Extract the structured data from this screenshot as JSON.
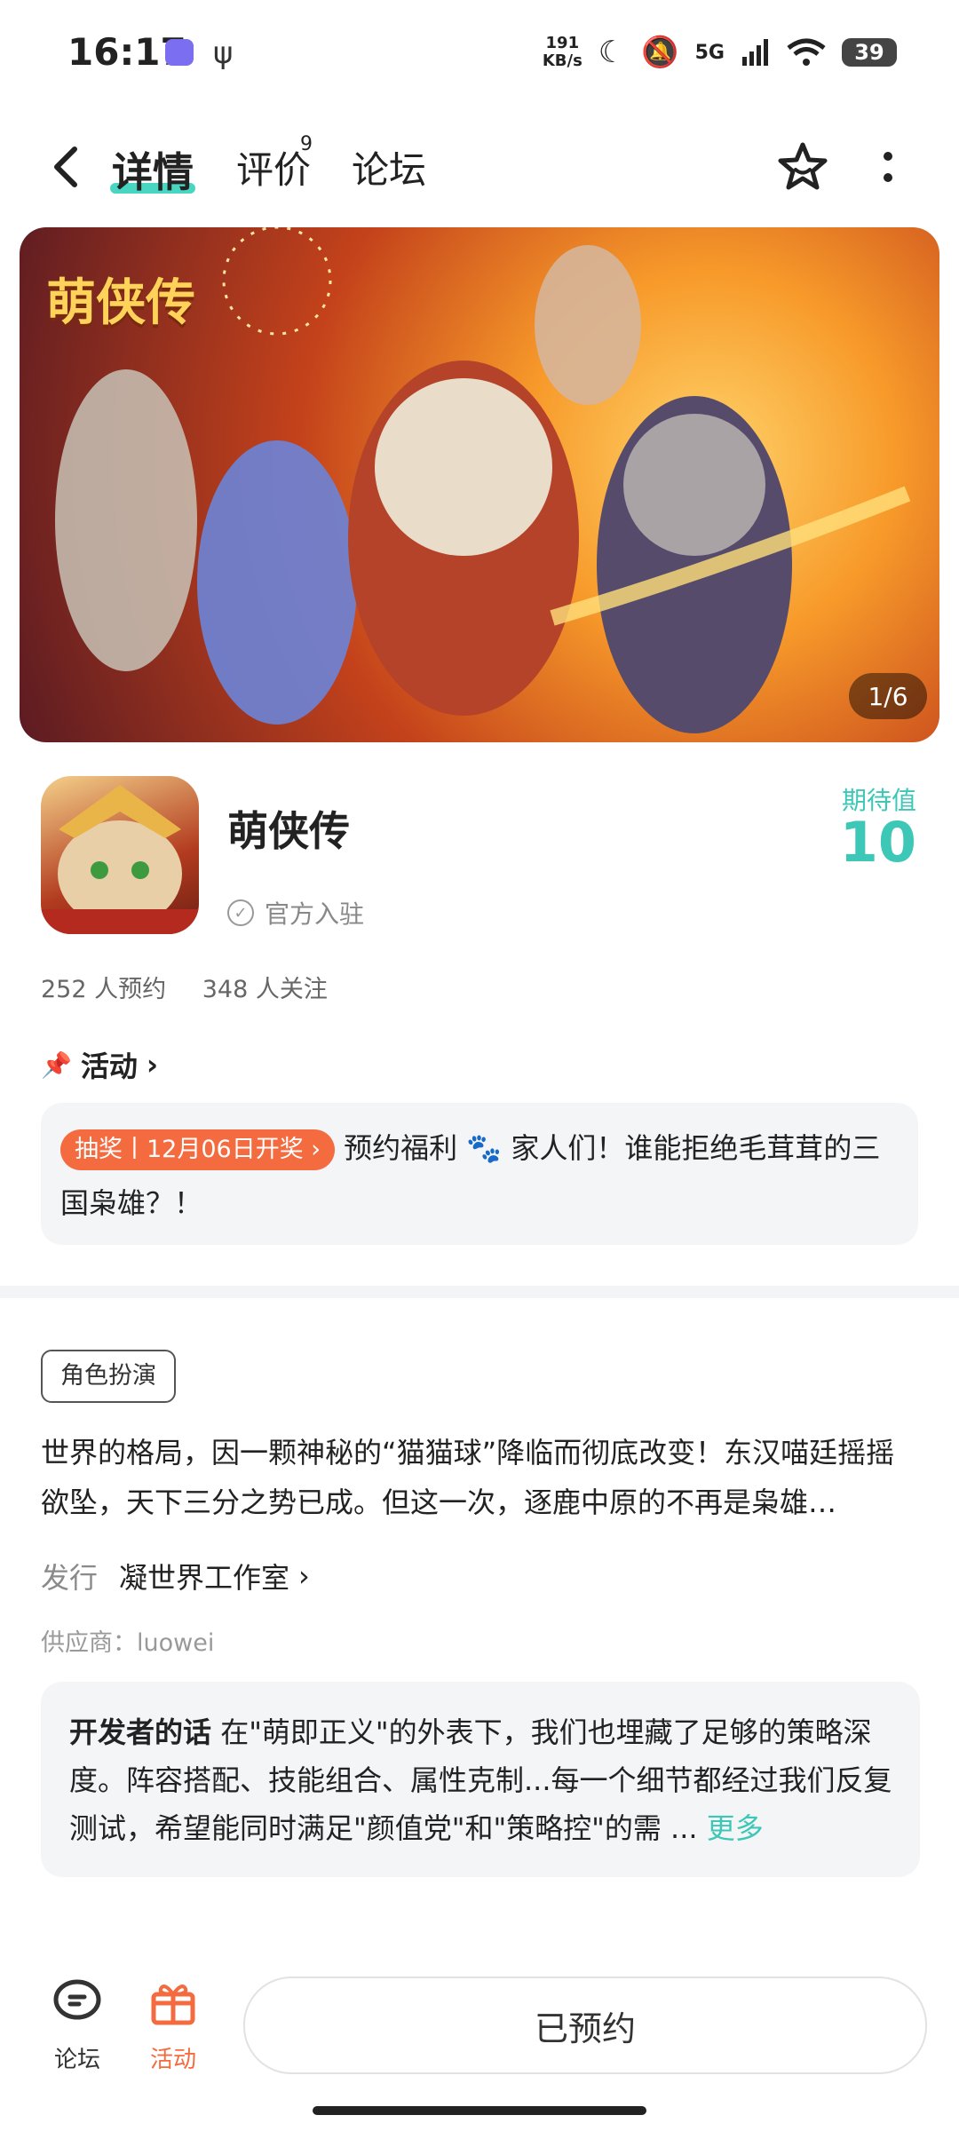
{
  "status_bar": {
    "time": "16:17",
    "net_speed_value": "191",
    "net_speed_unit": "KB/s",
    "network": "5G",
    "battery": "39"
  },
  "header": {
    "tabs": [
      {
        "label": "详情",
        "active": true
      },
      {
        "label": "评价",
        "badge": "9"
      },
      {
        "label": "论坛"
      }
    ]
  },
  "banner": {
    "logo_text": "萌侠传",
    "counter": "1/6"
  },
  "game": {
    "name": "萌侠传",
    "official_label": "官方入驻",
    "expect_label": "期待值",
    "expect_value": "10",
    "reservations": "252 人预约",
    "followers": "348 人关注"
  },
  "activity": {
    "heading": "活动",
    "lottery_badge": "抽奖丨12月06日开奖",
    "text_before_icon": "预约福利",
    "text_after_icon": "家人们！谁能拒绝毛茸茸的三国枭雄？！"
  },
  "details": {
    "genre_tag": "角色扮演",
    "description": "世界的格局，因一颗神秘的“猫猫球”降临而彻底改变！东汉喵廷摇摇欲坠，天下三分之势已成。但这一次，逐鹿中原的不再是枭雄…",
    "publisher_label": "发行",
    "publisher_name": "凝世界工作室",
    "supplier": "供应商：luowei",
    "dev_title": "开发者的话",
    "dev_text": "在\"萌即正义\"的外表下，我们也埋藏了足够的策略深度。阵容搭配、技能组合、属性克制...每一个细节都经过我们反复测试，希望能同时满足\"颜值党\"和\"策略控\"的需 ...",
    "more_label": "更多"
  },
  "bottom_bar": {
    "forum_label": "论坛",
    "activity_label": "活动",
    "reserve_label": "已预约"
  },
  "colors": {
    "accent": "#3cc7b6",
    "tab_underline": "#48d6c2",
    "lottery": "#f36b3f",
    "activity_active": "#f36b3f"
  }
}
